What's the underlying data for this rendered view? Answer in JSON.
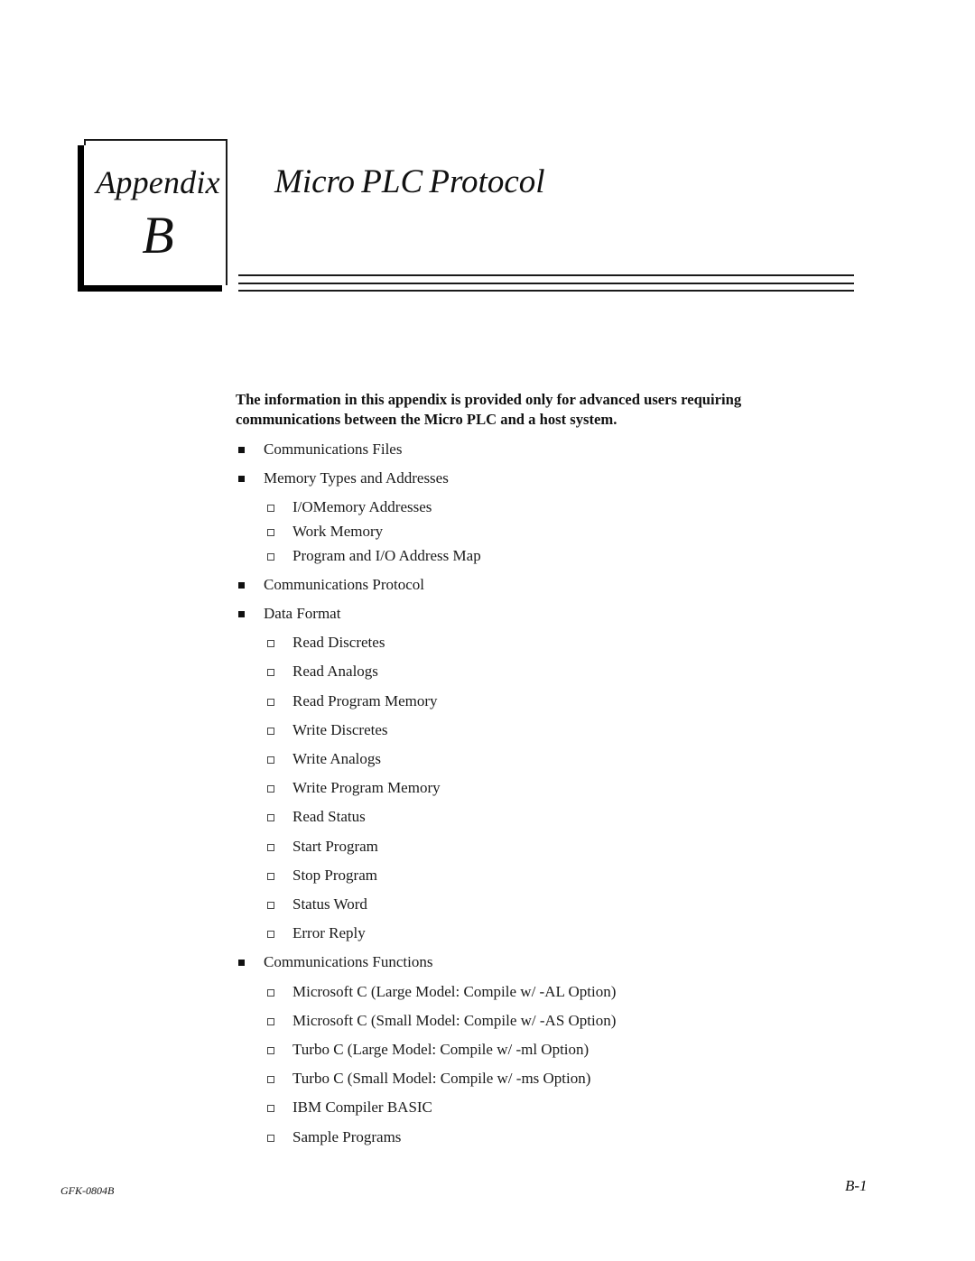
{
  "header": {
    "appendix_label": "Appendix",
    "appendix_letter": "B",
    "title": "Micro PLC Protocol"
  },
  "intro": "The information in this appendix is provided only for advanced users requiring communications between the Micro PLC and a host system.",
  "outline": [
    {
      "level": 1,
      "text": "Communications Files"
    },
    {
      "level": 1,
      "text": "Memory Types and Addresses"
    },
    {
      "level": 2,
      "text": "I/OMemory Addresses"
    },
    {
      "level": 2,
      "text": "Work Memory"
    },
    {
      "level": 2,
      "text": "Program and I/O Address Map"
    },
    {
      "level": 1,
      "text": "Communications Protocol"
    },
    {
      "level": 1,
      "text": "Data Format"
    },
    {
      "level": 2,
      "text": "Read Discretes"
    },
    {
      "level": 2,
      "text": "Read Analogs"
    },
    {
      "level": 2,
      "text": "Read Program Memory"
    },
    {
      "level": 2,
      "text": "Write Discretes"
    },
    {
      "level": 2,
      "text": "Write Analogs"
    },
    {
      "level": 2,
      "text": "Write Program Memory"
    },
    {
      "level": 2,
      "text": "Read Status"
    },
    {
      "level": 2,
      "text": "Start Program"
    },
    {
      "level": 2,
      "text": "Stop Program"
    },
    {
      "level": 2,
      "text": "Status Word"
    },
    {
      "level": 2,
      "text": "Error Reply"
    },
    {
      "level": 1,
      "text": "Communications Functions"
    },
    {
      "level": 2,
      "text": "Microsoft C (Large Model: Compile w/ -AL Option)"
    },
    {
      "level": 2,
      "text": "Microsoft C (Small Model: Compile w/ -AS Option)"
    },
    {
      "level": 2,
      "text": "Turbo C (Large Model: Compile w/ -ml Option)"
    },
    {
      "level": 2,
      "text": "Turbo C (Small Model: Compile w/ -ms Option)"
    },
    {
      "level": 2,
      "text": "IBM Compiler BASIC"
    },
    {
      "level": 2,
      "text": "Sample Programs"
    }
  ],
  "footer": {
    "doc_number": "GFK-0804B",
    "page_number": "B-1"
  }
}
